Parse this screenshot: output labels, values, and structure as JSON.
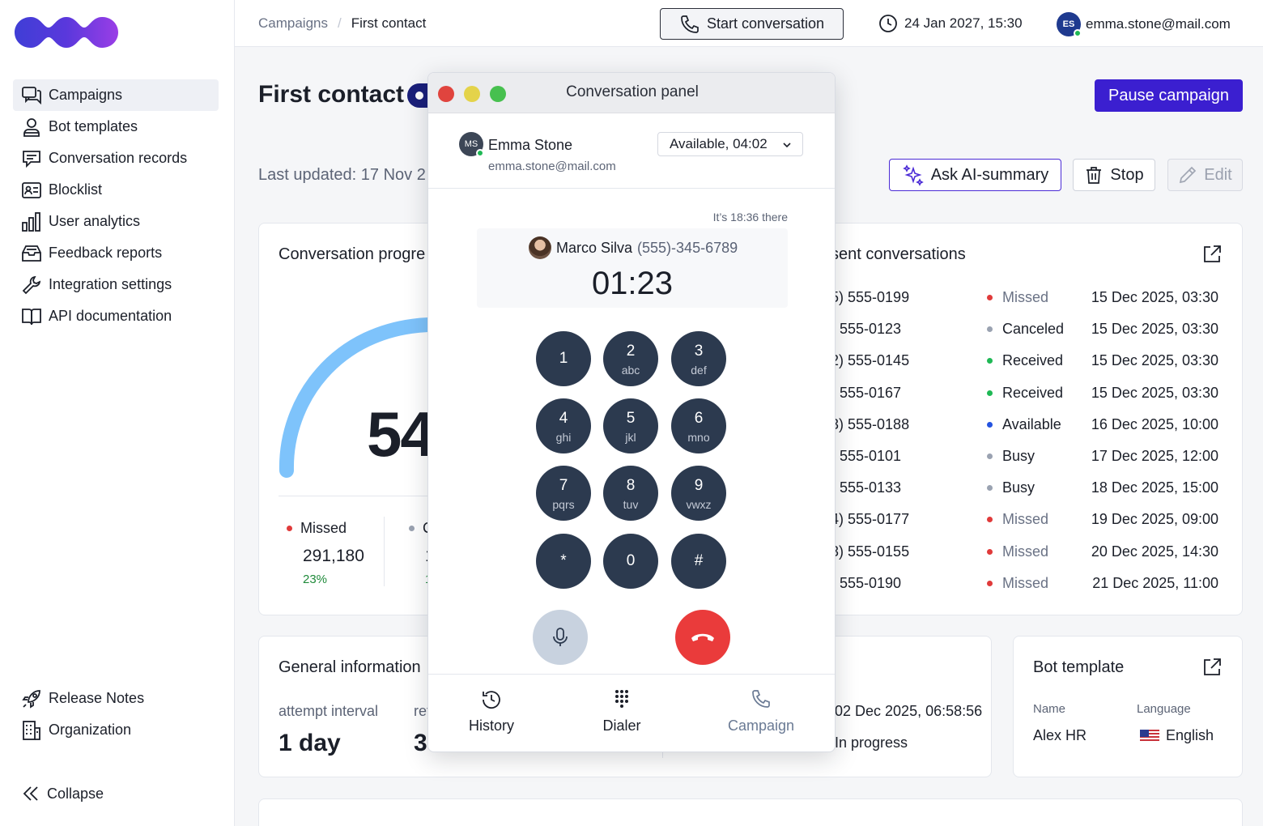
{
  "sidebar": {
    "items": [
      {
        "label": "Campaigns",
        "icon": "campaigns-icon"
      },
      {
        "label": "Bot templates",
        "icon": "bot-icon"
      },
      {
        "label": "Conversation records",
        "icon": "chat-icon"
      },
      {
        "label": "Blocklist",
        "icon": "id-card-icon"
      },
      {
        "label": "User analytics",
        "icon": "bar-chart-icon"
      },
      {
        "label": "Feedback reports",
        "icon": "inbox-icon"
      },
      {
        "label": "Integration settings",
        "icon": "wrench-icon"
      },
      {
        "label": "API documentation",
        "icon": "book-icon"
      }
    ],
    "bottom": [
      {
        "label": "Release Notes",
        "icon": "rocket-icon"
      },
      {
        "label": "Organization",
        "icon": "building-icon"
      }
    ],
    "collapse_label": "Collapse",
    "active_index": 0
  },
  "topbar": {
    "breadcrumb": [
      "Campaigns",
      "First contact"
    ],
    "start_conversation": "Start conversation",
    "datetime": "24 Jan 2027, 15:30",
    "user_initials": "ES",
    "user_email": "emma.stone@mail.com"
  },
  "page": {
    "title": "First contact",
    "last_updated": "Last updated: 17 Nov 2",
    "pause_label": "Pause campaign",
    "ai_label": "Ask AI-summary",
    "stop_label": "Stop",
    "edit_label": "Edit"
  },
  "progress": {
    "title": "Conversation progre",
    "gauge_value": "54",
    "stats": [
      {
        "label": "Missed",
        "value": "291,180",
        "percent": "23%",
        "color": "#e03a3a"
      },
      {
        "label": "C",
        "value": "1",
        "percent": "1",
        "color": "#9aa2b1"
      }
    ]
  },
  "recent": {
    "title": "sent conversations",
    "rows": [
      {
        "phone": "5) 555-0199",
        "status": "Missed",
        "color": "#e03a3a",
        "muted": true,
        "date": "15 Dec 2025, 03:30"
      },
      {
        "phone": ") 555-0123",
        "status": "Canceled",
        "color": "#9aa2b1",
        "muted": false,
        "date": "15 Dec 2025, 03:30"
      },
      {
        "phone": "2) 555-0145",
        "status": "Received",
        "color": "#1fb855",
        "muted": false,
        "date": "15 Dec 2025, 03:30"
      },
      {
        "phone": ") 555-0167",
        "status": "Received",
        "color": "#1fb855",
        "muted": false,
        "date": "15 Dec 2025, 03:30"
      },
      {
        "phone": "3) 555-0188",
        "status": "Available",
        "color": "#2453e0",
        "muted": false,
        "date": "16 Dec 2025, 10:00"
      },
      {
        "phone": ") 555-0101",
        "status": "Busy",
        "color": "#9aa2b1",
        "muted": false,
        "date": "17 Dec 2025, 12:00"
      },
      {
        "phone": ") 555-0133",
        "status": "Busy",
        "color": "#9aa2b1",
        "muted": false,
        "date": "18 Dec 2025, 15:00"
      },
      {
        "phone": "4) 555-0177",
        "status": "Missed",
        "color": "#e03a3a",
        "muted": true,
        "date": "19 Dec 2025, 09:00"
      },
      {
        "phone": "3) 555-0155",
        "status": "Missed",
        "color": "#e03a3a",
        "muted": true,
        "date": "20 Dec 2025, 14:30"
      },
      {
        "phone": ") 555-0190",
        "status": "Missed",
        "color": "#e03a3a",
        "muted": true,
        "date": "21 Dec 2025, 11:00"
      }
    ]
  },
  "general": {
    "title": "General information",
    "attempt_label": "attempt interval",
    "attempt_value": "1 day",
    "retry_label": "ret",
    "retry_value": "3",
    "date_value": "02 Dec 2025, 06:58:56",
    "status_value": "In progress"
  },
  "bot_template": {
    "title": "Bot template",
    "name_label": "Name",
    "name_value": "Alex HR",
    "language_label": "Language",
    "language_value": "English"
  },
  "modal": {
    "title": "Conversation panel",
    "agent_initials": "MS",
    "agent_name": "Emma Stone",
    "agent_email": "emma.stone@mail.com",
    "status": "Available, 04:02",
    "local_time": "It’s 18:36 there",
    "caller_name": "Marco Silva",
    "caller_phone": "(555)-345-6789",
    "timer": "01:23",
    "keys": [
      {
        "d": "1",
        "l": ""
      },
      {
        "d": "2",
        "l": "abc"
      },
      {
        "d": "3",
        "l": "def"
      },
      {
        "d": "4",
        "l": "ghi"
      },
      {
        "d": "5",
        "l": "jkl"
      },
      {
        "d": "6",
        "l": "mno"
      },
      {
        "d": "7",
        "l": "pqrs"
      },
      {
        "d": "8",
        "l": "tuv"
      },
      {
        "d": "9",
        "l": "vwxz"
      },
      {
        "d": "*",
        "l": ""
      },
      {
        "d": "0",
        "l": ""
      },
      {
        "d": "#",
        "l": ""
      }
    ],
    "tabs": [
      {
        "label": "History",
        "icon": "history-icon"
      },
      {
        "label": "Dialer",
        "icon": "dialpad-icon"
      },
      {
        "label": "Campaign",
        "icon": "phone-icon"
      }
    ]
  },
  "colors": {
    "accent": "#3b1fd0",
    "gauge": "#7ec3fb",
    "hangup": "#ea3b3b",
    "key": "#2c3a4f"
  }
}
